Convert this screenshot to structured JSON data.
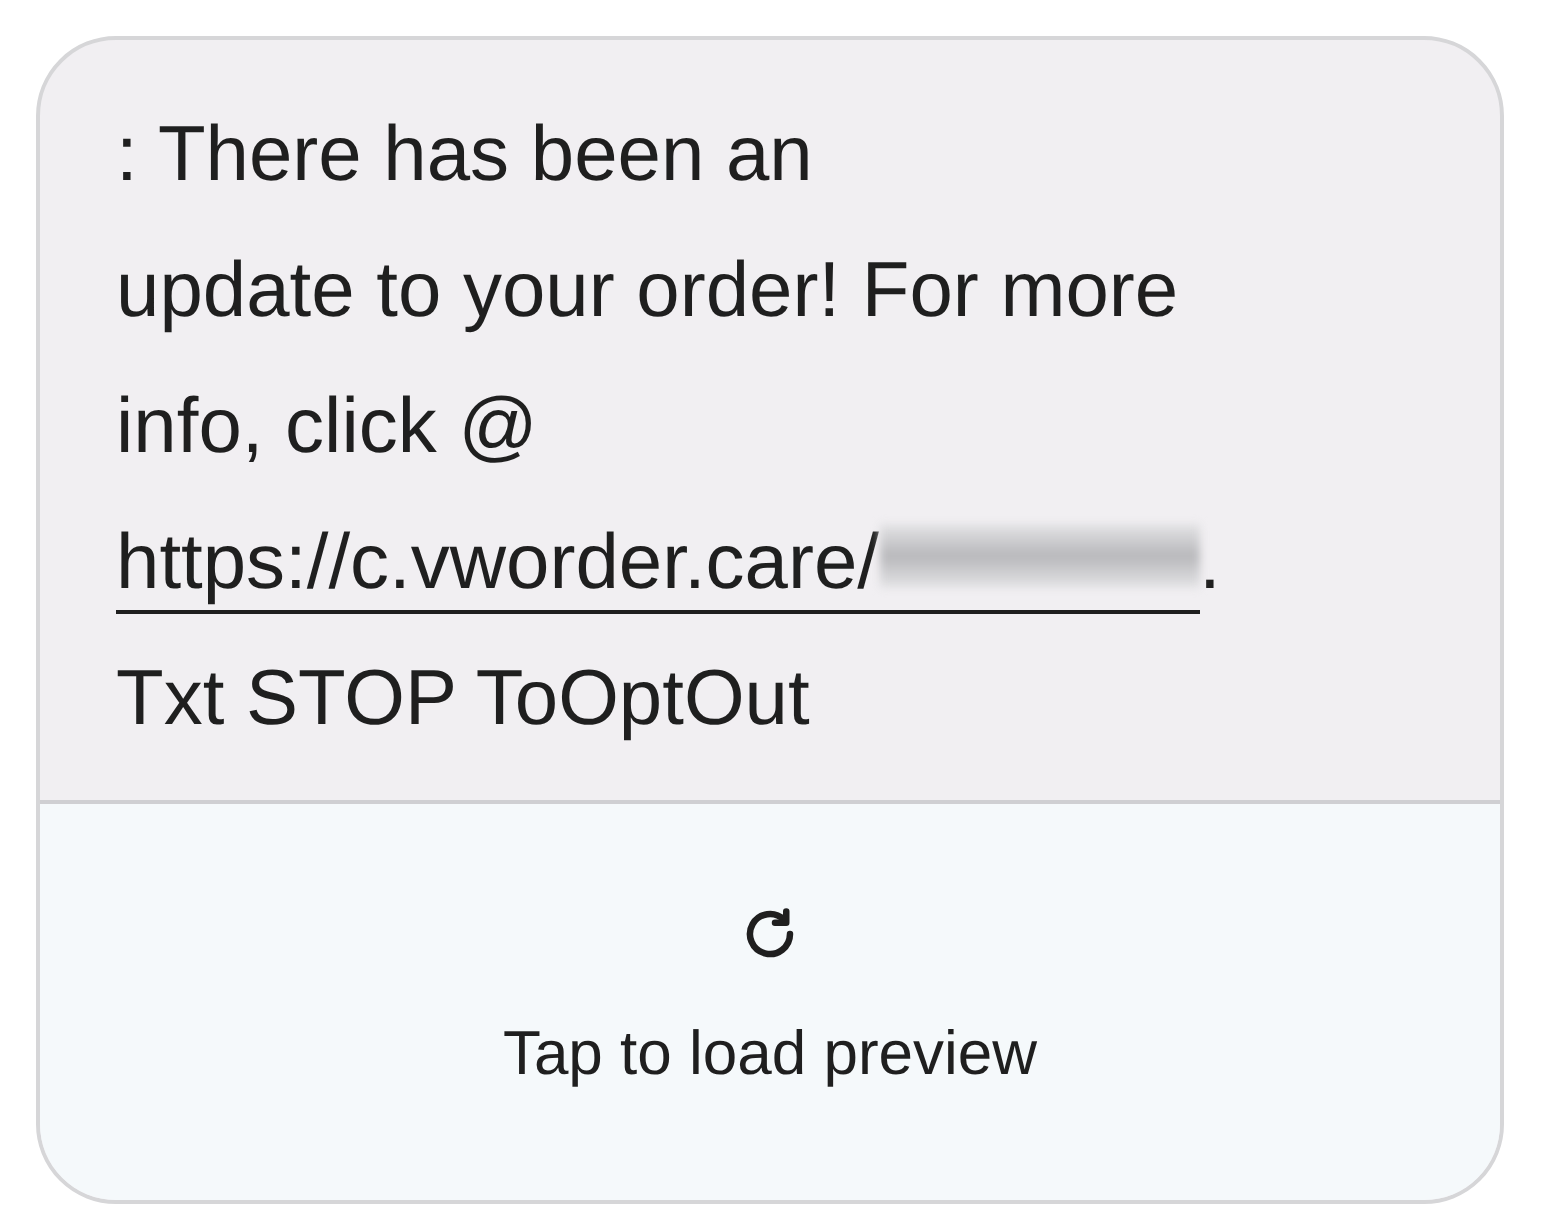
{
  "message": {
    "lines_before": [
      ": There has been an",
      "update to your order! For more",
      "info, click @"
    ],
    "link": {
      "text": "https://c.vworder.care/",
      "redacted": true
    },
    "after_link": ".",
    "lines_after": [
      "Txt STOP ToOptOut"
    ]
  },
  "preview": {
    "label": "Tap to load preview"
  }
}
